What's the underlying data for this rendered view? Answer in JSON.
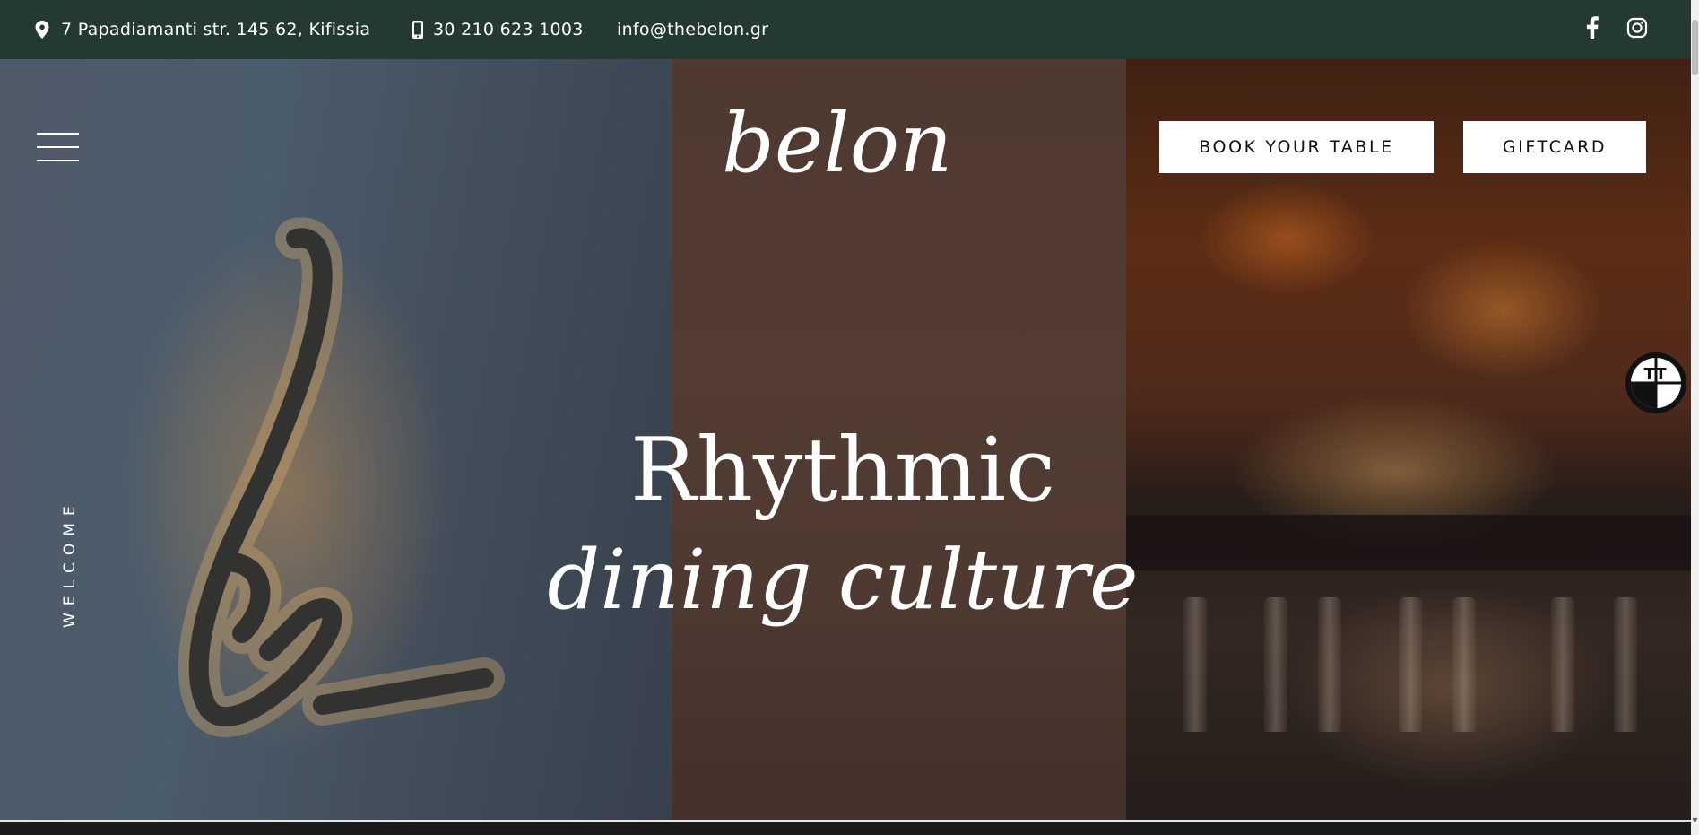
{
  "top_bar": {
    "address": "7 Papadiamanti str. 145 62, Kifissia",
    "phone": "30 210 623 1003",
    "email": "info@thebelon.gr",
    "icons": [
      "location-pin-icon",
      "phone-icon",
      "facebook-icon",
      "instagram-icon"
    ]
  },
  "header": {
    "logo_text": "belon.",
    "book_button": "BOOK YOUR TABLE",
    "giftcard_button": "GIFTCARD",
    "menu_icon": "hamburger-menu-icon"
  },
  "hero": {
    "side_label": "WELCOME",
    "headline_line1": "Rhythmic",
    "headline_line2": "dining culture"
  },
  "widget": {
    "label": "TT",
    "icon": "text-size-accessibility-icon"
  },
  "colors": {
    "top_bar_bg": "#243a31",
    "button_bg": "#ffffff",
    "button_text": "#111111",
    "text_light": "#ffffff"
  }
}
